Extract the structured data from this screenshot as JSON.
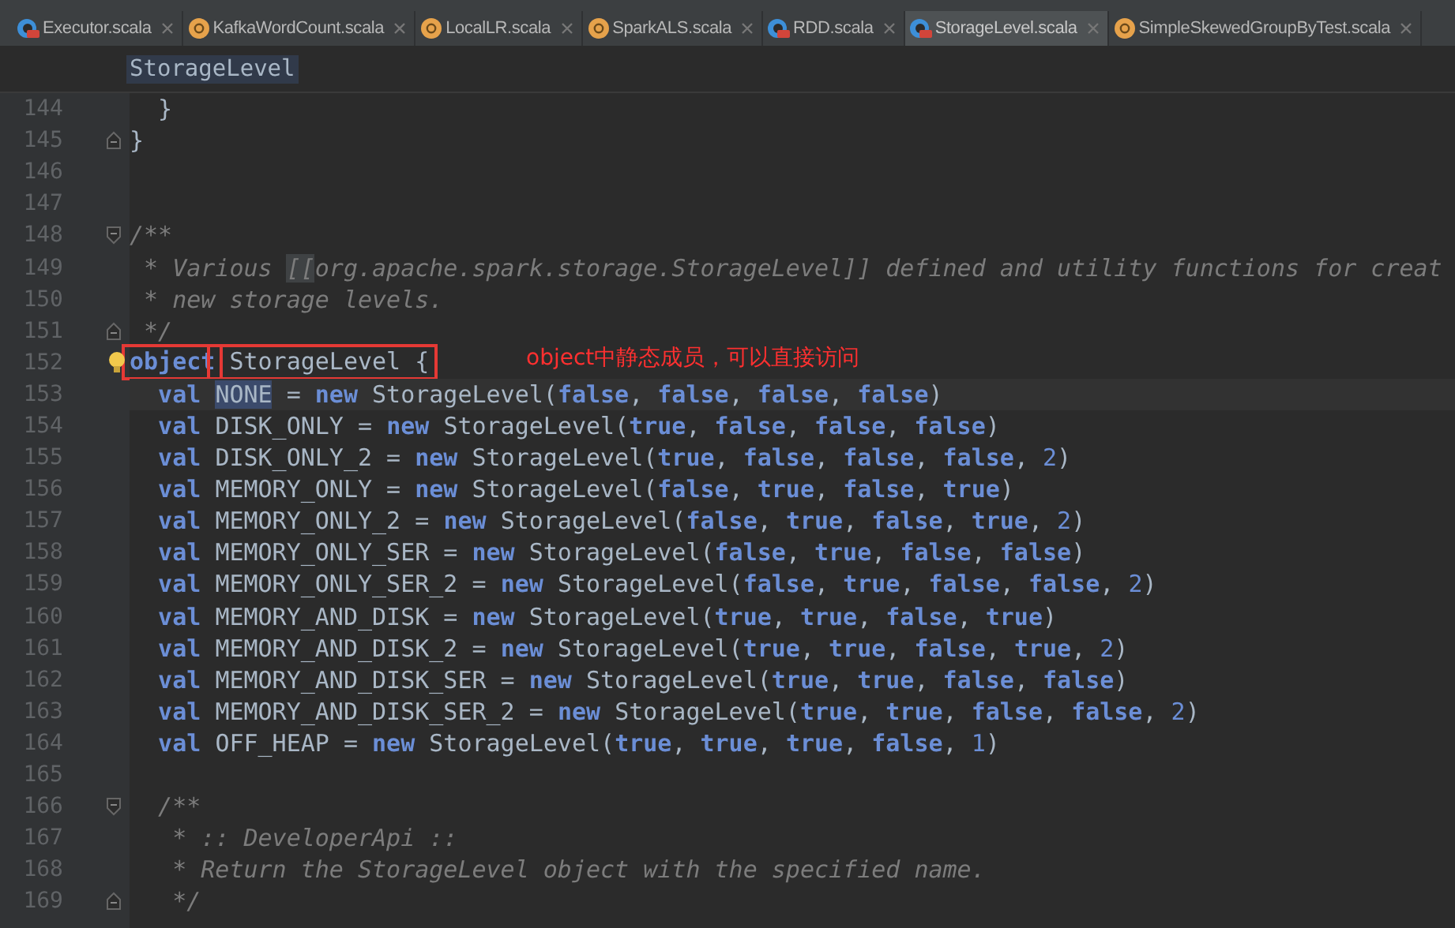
{
  "tabs": [
    {
      "label": "Executor.scala",
      "kind": "scala",
      "selected": false
    },
    {
      "label": "KafkaWordCount.scala",
      "kind": "object",
      "selected": false
    },
    {
      "label": "LocalLR.scala",
      "kind": "object",
      "selected": false
    },
    {
      "label": "SparkALS.scala",
      "kind": "object",
      "selected": false
    },
    {
      "label": "RDD.scala",
      "kind": "scala",
      "selected": false
    },
    {
      "label": "StorageLevel.scala",
      "kind": "scala",
      "selected": true
    },
    {
      "label": "SimpleSkewedGroupByTest.scala",
      "kind": "object",
      "selected": false
    }
  ],
  "breadcrumb": "StorageLevel",
  "lines": [
    {
      "number": "144",
      "tokens": [
        {
          "text": "  }",
          "kind": "id"
        }
      ]
    },
    {
      "number": "145",
      "fold_end": true,
      "tokens": [
        {
          "text": "}",
          "kind": "id"
        }
      ]
    },
    {
      "number": "146"
    },
    {
      "number": "147"
    },
    {
      "number": "148",
      "fold_start": true,
      "tokens": [
        {
          "text": "/**",
          "kind": "doc"
        }
      ]
    },
    {
      "number": "149",
      "tokens": [
        {
          "text": " * Various ",
          "kind": "doc"
        },
        {
          "text": "[[",
          "kind": "doc",
          "highlight": true
        },
        {
          "text": "org.apache.spark.storage.StorageLevel]] defined and utility functions for creat",
          "kind": "doc"
        }
      ]
    },
    {
      "number": "150",
      "tokens": [
        {
          "text": " * new storage levels.",
          "kind": "doc"
        }
      ]
    },
    {
      "number": "151",
      "fold_end": true,
      "tokens": [
        {
          "text": " */",
          "kind": "doc"
        }
      ]
    },
    {
      "number": "152",
      "bulb": true,
      "note": "object中静态成员，可以直接访问",
      "tokens": [
        {
          "text": "object",
          "kind": "kw",
          "boxed": true
        },
        {
          "text": " StorageLevel {",
          "kind": "id",
          "boxed": true
        }
      ]
    },
    {
      "number": "153",
      "current": true,
      "tokens": [
        {
          "text": "  val ",
          "kind": "kw"
        },
        {
          "text": "NONE",
          "kind": "id",
          "highlight": true
        },
        {
          "text": " = ",
          "kind": "id"
        },
        {
          "text": "new ",
          "kind": "kw"
        },
        {
          "text": "StorageLevel(",
          "kind": "id"
        },
        {
          "text": "false",
          "kind": "kw"
        },
        {
          "text": ", ",
          "kind": "id"
        },
        {
          "text": "false",
          "kind": "kw"
        },
        {
          "text": ", ",
          "kind": "id"
        },
        {
          "text": "false",
          "kind": "kw"
        },
        {
          "text": ", ",
          "kind": "id"
        },
        {
          "text": "false",
          "kind": "kw"
        },
        {
          "text": ")",
          "kind": "id"
        }
      ]
    },
    {
      "number": "154",
      "tokens": [
        {
          "text": "  val ",
          "kind": "kw"
        },
        {
          "text": "DISK_ONLY = ",
          "kind": "id"
        },
        {
          "text": "new ",
          "kind": "kw"
        },
        {
          "text": "StorageLevel(",
          "kind": "id"
        },
        {
          "text": "true",
          "kind": "kw"
        },
        {
          "text": ", ",
          "kind": "id"
        },
        {
          "text": "false",
          "kind": "kw"
        },
        {
          "text": ", ",
          "kind": "id"
        },
        {
          "text": "false",
          "kind": "kw"
        },
        {
          "text": ", ",
          "kind": "id"
        },
        {
          "text": "false",
          "kind": "kw"
        },
        {
          "text": ")",
          "kind": "id"
        }
      ]
    },
    {
      "number": "155",
      "tokens": [
        {
          "text": "  val ",
          "kind": "kw"
        },
        {
          "text": "DISK_ONLY_2 = ",
          "kind": "id"
        },
        {
          "text": "new ",
          "kind": "kw"
        },
        {
          "text": "StorageLevel(",
          "kind": "id"
        },
        {
          "text": "true",
          "kind": "kw"
        },
        {
          "text": ", ",
          "kind": "id"
        },
        {
          "text": "false",
          "kind": "kw"
        },
        {
          "text": ", ",
          "kind": "id"
        },
        {
          "text": "false",
          "kind": "kw"
        },
        {
          "text": ", ",
          "kind": "id"
        },
        {
          "text": "false",
          "kind": "kw"
        },
        {
          "text": ", ",
          "kind": "id"
        },
        {
          "text": "2",
          "kind": "num"
        },
        {
          "text": ")",
          "kind": "id"
        }
      ]
    },
    {
      "number": "156",
      "tokens": [
        {
          "text": "  val ",
          "kind": "kw"
        },
        {
          "text": "MEMORY_ONLY = ",
          "kind": "id"
        },
        {
          "text": "new ",
          "kind": "kw"
        },
        {
          "text": "StorageLevel(",
          "kind": "id"
        },
        {
          "text": "false",
          "kind": "kw"
        },
        {
          "text": ", ",
          "kind": "id"
        },
        {
          "text": "true",
          "kind": "kw"
        },
        {
          "text": ", ",
          "kind": "id"
        },
        {
          "text": "false",
          "kind": "kw"
        },
        {
          "text": ", ",
          "kind": "id"
        },
        {
          "text": "true",
          "kind": "kw"
        },
        {
          "text": ")",
          "kind": "id"
        }
      ]
    },
    {
      "number": "157",
      "tokens": [
        {
          "text": "  val ",
          "kind": "kw"
        },
        {
          "text": "MEMORY_ONLY_2 = ",
          "kind": "id"
        },
        {
          "text": "new ",
          "kind": "kw"
        },
        {
          "text": "StorageLevel(",
          "kind": "id"
        },
        {
          "text": "false",
          "kind": "kw"
        },
        {
          "text": ", ",
          "kind": "id"
        },
        {
          "text": "true",
          "kind": "kw"
        },
        {
          "text": ", ",
          "kind": "id"
        },
        {
          "text": "false",
          "kind": "kw"
        },
        {
          "text": ", ",
          "kind": "id"
        },
        {
          "text": "true",
          "kind": "kw"
        },
        {
          "text": ", ",
          "kind": "id"
        },
        {
          "text": "2",
          "kind": "num"
        },
        {
          "text": ")",
          "kind": "id"
        }
      ]
    },
    {
      "number": "158",
      "tokens": [
        {
          "text": "  val ",
          "kind": "kw"
        },
        {
          "text": "MEMORY_ONLY_SER = ",
          "kind": "id"
        },
        {
          "text": "new ",
          "kind": "kw"
        },
        {
          "text": "StorageLevel(",
          "kind": "id"
        },
        {
          "text": "false",
          "kind": "kw"
        },
        {
          "text": ", ",
          "kind": "id"
        },
        {
          "text": "true",
          "kind": "kw"
        },
        {
          "text": ", ",
          "kind": "id"
        },
        {
          "text": "false",
          "kind": "kw"
        },
        {
          "text": ", ",
          "kind": "id"
        },
        {
          "text": "false",
          "kind": "kw"
        },
        {
          "text": ")",
          "kind": "id"
        }
      ]
    },
    {
      "number": "159",
      "tokens": [
        {
          "text": "  val ",
          "kind": "kw"
        },
        {
          "text": "MEMORY_ONLY_SER_2 = ",
          "kind": "id"
        },
        {
          "text": "new ",
          "kind": "kw"
        },
        {
          "text": "StorageLevel(",
          "kind": "id"
        },
        {
          "text": "false",
          "kind": "kw"
        },
        {
          "text": ", ",
          "kind": "id"
        },
        {
          "text": "true",
          "kind": "kw"
        },
        {
          "text": ", ",
          "kind": "id"
        },
        {
          "text": "false",
          "kind": "kw"
        },
        {
          "text": ", ",
          "kind": "id"
        },
        {
          "text": "false",
          "kind": "kw"
        },
        {
          "text": ", ",
          "kind": "id"
        },
        {
          "text": "2",
          "kind": "num"
        },
        {
          "text": ")",
          "kind": "id"
        }
      ]
    },
    {
      "number": "160",
      "tokens": [
        {
          "text": "  val ",
          "kind": "kw"
        },
        {
          "text": "MEMORY_AND_DISK = ",
          "kind": "id"
        },
        {
          "text": "new ",
          "kind": "kw"
        },
        {
          "text": "StorageLevel(",
          "kind": "id"
        },
        {
          "text": "true",
          "kind": "kw"
        },
        {
          "text": ", ",
          "kind": "id"
        },
        {
          "text": "true",
          "kind": "kw"
        },
        {
          "text": ", ",
          "kind": "id"
        },
        {
          "text": "false",
          "kind": "kw"
        },
        {
          "text": ", ",
          "kind": "id"
        },
        {
          "text": "true",
          "kind": "kw"
        },
        {
          "text": ")",
          "kind": "id"
        }
      ]
    },
    {
      "number": "161",
      "tokens": [
        {
          "text": "  val ",
          "kind": "kw"
        },
        {
          "text": "MEMORY_AND_DISK_2 = ",
          "kind": "id"
        },
        {
          "text": "new ",
          "kind": "kw"
        },
        {
          "text": "StorageLevel(",
          "kind": "id"
        },
        {
          "text": "true",
          "kind": "kw"
        },
        {
          "text": ", ",
          "kind": "id"
        },
        {
          "text": "true",
          "kind": "kw"
        },
        {
          "text": ", ",
          "kind": "id"
        },
        {
          "text": "false",
          "kind": "kw"
        },
        {
          "text": ", ",
          "kind": "id"
        },
        {
          "text": "true",
          "kind": "kw"
        },
        {
          "text": ", ",
          "kind": "id"
        },
        {
          "text": "2",
          "kind": "num"
        },
        {
          "text": ")",
          "kind": "id"
        }
      ]
    },
    {
      "number": "162",
      "tokens": [
        {
          "text": "  val ",
          "kind": "kw"
        },
        {
          "text": "MEMORY_AND_DISK_SER = ",
          "kind": "id"
        },
        {
          "text": "new ",
          "kind": "kw"
        },
        {
          "text": "StorageLevel(",
          "kind": "id"
        },
        {
          "text": "true",
          "kind": "kw"
        },
        {
          "text": ", ",
          "kind": "id"
        },
        {
          "text": "true",
          "kind": "kw"
        },
        {
          "text": ", ",
          "kind": "id"
        },
        {
          "text": "false",
          "kind": "kw"
        },
        {
          "text": ", ",
          "kind": "id"
        },
        {
          "text": "false",
          "kind": "kw"
        },
        {
          "text": ")",
          "kind": "id"
        }
      ]
    },
    {
      "number": "163",
      "tokens": [
        {
          "text": "  val ",
          "kind": "kw"
        },
        {
          "text": "MEMORY_AND_DISK_SER_2 = ",
          "kind": "id"
        },
        {
          "text": "new ",
          "kind": "kw"
        },
        {
          "text": "StorageLevel(",
          "kind": "id"
        },
        {
          "text": "true",
          "kind": "kw"
        },
        {
          "text": ", ",
          "kind": "id"
        },
        {
          "text": "true",
          "kind": "kw"
        },
        {
          "text": ", ",
          "kind": "id"
        },
        {
          "text": "false",
          "kind": "kw"
        },
        {
          "text": ", ",
          "kind": "id"
        },
        {
          "text": "false",
          "kind": "kw"
        },
        {
          "text": ", ",
          "kind": "id"
        },
        {
          "text": "2",
          "kind": "num"
        },
        {
          "text": ")",
          "kind": "id"
        }
      ]
    },
    {
      "number": "164",
      "tokens": [
        {
          "text": "  val ",
          "kind": "kw"
        },
        {
          "text": "OFF_HEAP = ",
          "kind": "id"
        },
        {
          "text": "new ",
          "kind": "kw"
        },
        {
          "text": "StorageLevel(",
          "kind": "id"
        },
        {
          "text": "true",
          "kind": "kw"
        },
        {
          "text": ", ",
          "kind": "id"
        },
        {
          "text": "true",
          "kind": "kw"
        },
        {
          "text": ", ",
          "kind": "id"
        },
        {
          "text": "true",
          "kind": "kw"
        },
        {
          "text": ", ",
          "kind": "id"
        },
        {
          "text": "false",
          "kind": "kw"
        },
        {
          "text": ", ",
          "kind": "id"
        },
        {
          "text": "1",
          "kind": "num"
        },
        {
          "text": ")",
          "kind": "id"
        }
      ]
    },
    {
      "number": "165"
    },
    {
      "number": "166",
      "fold_start": true,
      "tokens": [
        {
          "text": "  /**",
          "kind": "doc"
        }
      ]
    },
    {
      "number": "167",
      "tokens": [
        {
          "text": "   * :: DeveloperApi ::",
          "kind": "doc"
        }
      ]
    },
    {
      "number": "168",
      "tokens": [
        {
          "text": "   * Return the StorageLevel object with the specified name.",
          "kind": "doc"
        }
      ]
    },
    {
      "number": "169",
      "fold_end": true,
      "tokens": [
        {
          "text": "   */",
          "kind": "doc"
        }
      ]
    }
  ]
}
